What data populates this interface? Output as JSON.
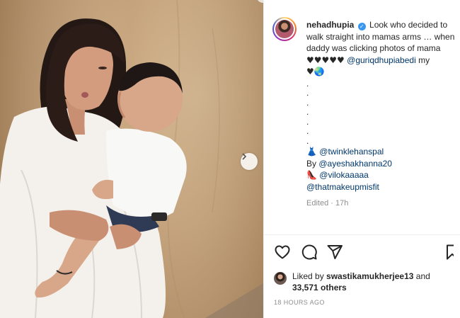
{
  "post": {
    "username": "nehadhupia",
    "caption_text": "Look who decided to walk straight into mamas arms … when daddy was clicking photos of mama",
    "caption_hearts": "♥♥♥♥♥",
    "caption_mention": "@guriqdhupiabedi",
    "caption_tail": " my",
    "caption_line2": "♥",
    "caption_globe": "🌏",
    "dots": [
      ".",
      ".",
      ".",
      ".",
      ".",
      ".",
      "."
    ],
    "credits": [
      {
        "prefix": "",
        "emoji": "👗",
        "handle": "@twinklehanspal"
      },
      {
        "prefix": "By ",
        "emoji": "",
        "handle": "@ayeshakhanna20"
      },
      {
        "prefix": "",
        "emoji": "👠",
        "handle": "@vilokaaaaa"
      },
      {
        "prefix": "",
        "emoji": "",
        "handle": "@thatmakeupmisfit"
      }
    ],
    "edited": "Edited · 17h"
  },
  "likes": {
    "prefix": "Liked by ",
    "liker": "swastikamukherjee13",
    "and": " and",
    "others": "33,571 others"
  },
  "timestamp": "18 HOURS AGO",
  "icons": {
    "like": "heart-icon",
    "comment": "comment-icon",
    "share": "share-icon",
    "save": "bookmark-icon",
    "next": "chevron-right-icon",
    "verified": "verified-badge-icon"
  },
  "colors": {
    "mention": "#00376b",
    "muted": "#8e8e8e",
    "verified": "#3897f0"
  }
}
